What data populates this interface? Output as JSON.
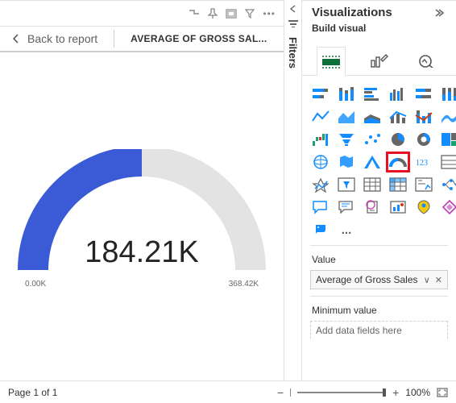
{
  "header": {
    "back_label": "Back to report",
    "visual_title": "AVERAGE OF GROSS SAL..."
  },
  "chart_data": {
    "type": "gauge",
    "title": "Average of Gross Sales",
    "value": 184.21,
    "min": 0.0,
    "max": 368.42,
    "unit": "K",
    "display_value": "184.21K",
    "display_min": "0.00K",
    "display_max": "368.42K",
    "fill_color": "#3b5bd6",
    "track_color": "#e3e3e3"
  },
  "filters": {
    "label": "Filters"
  },
  "viz_pane": {
    "title": "Visualizations",
    "subtitle": "Build visual",
    "tabs": [
      "fields",
      "format",
      "analytics"
    ],
    "visual_types": [
      "stacked-bar",
      "stacked-column",
      "clustered-bar",
      "clustered-column",
      "stacked-bar-100",
      "stacked-column-100",
      "line",
      "area",
      "stacked-area",
      "line-clustered-column",
      "line-stacked-column",
      "ribbon",
      "waterfall",
      "funnel",
      "scatter",
      "pie",
      "donut",
      "treemap",
      "map",
      "filled-map",
      "azure-map",
      "gauge",
      "card",
      "multi-row-card",
      "kpi",
      "slicer",
      "table",
      "matrix",
      "r-visual",
      "decomposition-tree",
      "qa",
      "smart-narrative",
      "paginated",
      "data-story",
      "arcgis",
      "power-apps",
      "python"
    ],
    "highlighted_visual": "gauge",
    "sections": {
      "value": {
        "label": "Value",
        "field": "Average of Gross Sales"
      },
      "min": {
        "label": "Minimum value",
        "placeholder": "Add data fields here"
      }
    },
    "more": "..."
  },
  "footer": {
    "page_label": "Page 1 of 1",
    "zoom_pct": "100%"
  }
}
